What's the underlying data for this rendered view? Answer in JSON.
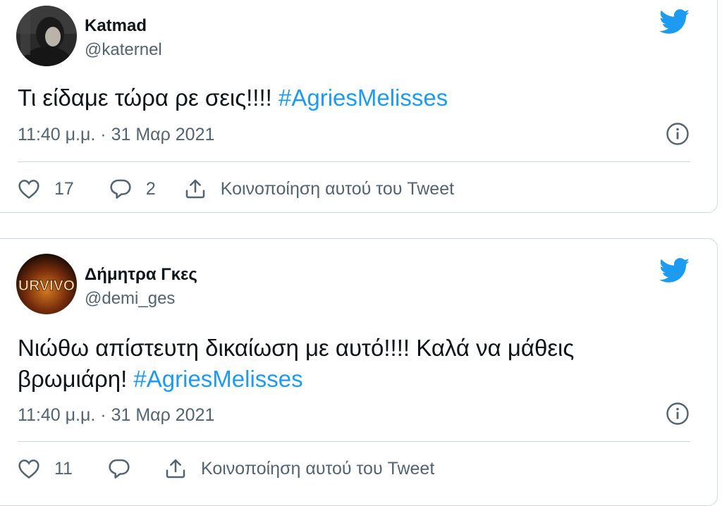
{
  "tweets": [
    {
      "display_name": "Katmad",
      "handle": "@katernel",
      "text_plain": "Τι είδαμε τώρα ρε σεις!!!! ",
      "hashtag": "#AgriesMelisses",
      "timestamp": "11:40 μ.μ. · 31 Μαρ 2021",
      "likes": "17",
      "replies": "2",
      "share_label": "Κοινοποίηση αυτού του Tweet"
    },
    {
      "display_name": "Δήμητρα Γκες",
      "handle": "@demi_ges",
      "avatar_text": "URVIVO",
      "text_line1": "Νιώθω απίστευτη δικαίωση με αυτό!!!! Καλά να μάθεις",
      "text_line2": "βρωμιάρη! ",
      "hashtag": "#AgriesMelisses",
      "timestamp": "11:40 μ.μ. · 31 Μαρ 2021",
      "likes": "11",
      "share_label": "Κοινοποίηση αυτού του Tweet"
    }
  ],
  "colors": {
    "brand_blue": "#1d9bf0",
    "secondary_text": "#536471",
    "border": "#cfd9de"
  },
  "icons": [
    "twitter-bird-icon",
    "info-icon",
    "heart-icon",
    "reply-icon",
    "share-icon"
  ]
}
